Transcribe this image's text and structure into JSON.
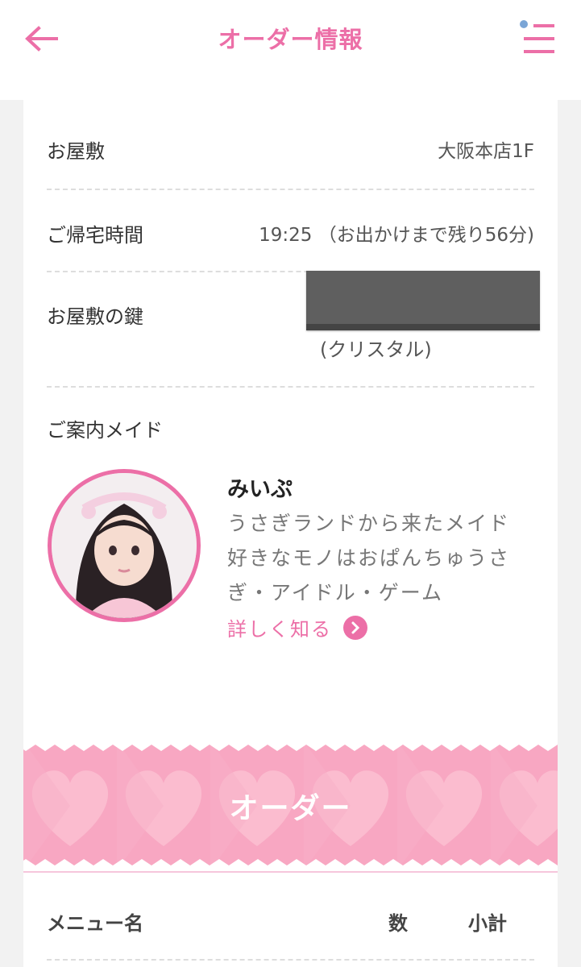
{
  "header": {
    "title": "オーダー情報",
    "back_icon": "arrow-left-icon",
    "menu_icon": "hamburger-menu-icon",
    "accent_color": "#ec6fa7"
  },
  "info": {
    "mansion_label": "お屋敷",
    "mansion_value": "大阪本店1F",
    "return_label": "ご帰宅時間",
    "return_value": "19:25 （お出かけまで残り56分)",
    "key_label": "お屋敷の鍵",
    "key_type": "(クリスタル)"
  },
  "guide": {
    "title": "ご案内メイド",
    "maid_name": "みいぷ",
    "description": "うさぎランドから来たメイド好きなモノはおぱんちゅうさぎ・アイドル・ゲーム",
    "more_label": "詳しく知る"
  },
  "order": {
    "banner_title": "オーダー",
    "col_menu": "メニュー名",
    "col_qty": "数",
    "col_subtotal": "小計"
  }
}
